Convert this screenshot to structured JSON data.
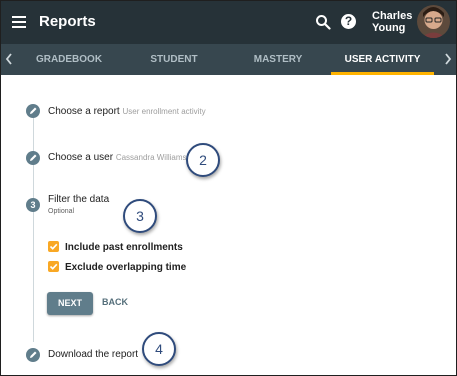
{
  "header": {
    "title": "Reports",
    "user": {
      "first": "Charles",
      "last": "Young"
    }
  },
  "tabs": [
    {
      "label": "GRADEBOOK",
      "active": false
    },
    {
      "label": "STUDENT",
      "active": false
    },
    {
      "label": "MASTERY",
      "active": false
    },
    {
      "label": "USER ACTIVITY",
      "active": true
    }
  ],
  "steps": [
    {
      "title": "Choose a report",
      "value": "User enrollment activity"
    },
    {
      "title": "Choose a user",
      "value": "Cassandra Williams"
    },
    {
      "number": "3",
      "title": "Filter the data",
      "optional": "Optional"
    },
    {
      "title": "Download the report"
    }
  ],
  "filters": [
    {
      "label": "Include past enrollments",
      "checked": true
    },
    {
      "label": "Exclude overlapping time",
      "checked": true
    }
  ],
  "buttons": {
    "next": "NEXT",
    "back": "BACK"
  },
  "callouts": [
    "2",
    "3",
    "4"
  ],
  "colors": {
    "header": "#263238",
    "tabs": "#37474f",
    "accent": "#ffb300",
    "checkbox": "#f9a825",
    "step": "#607d8b"
  }
}
